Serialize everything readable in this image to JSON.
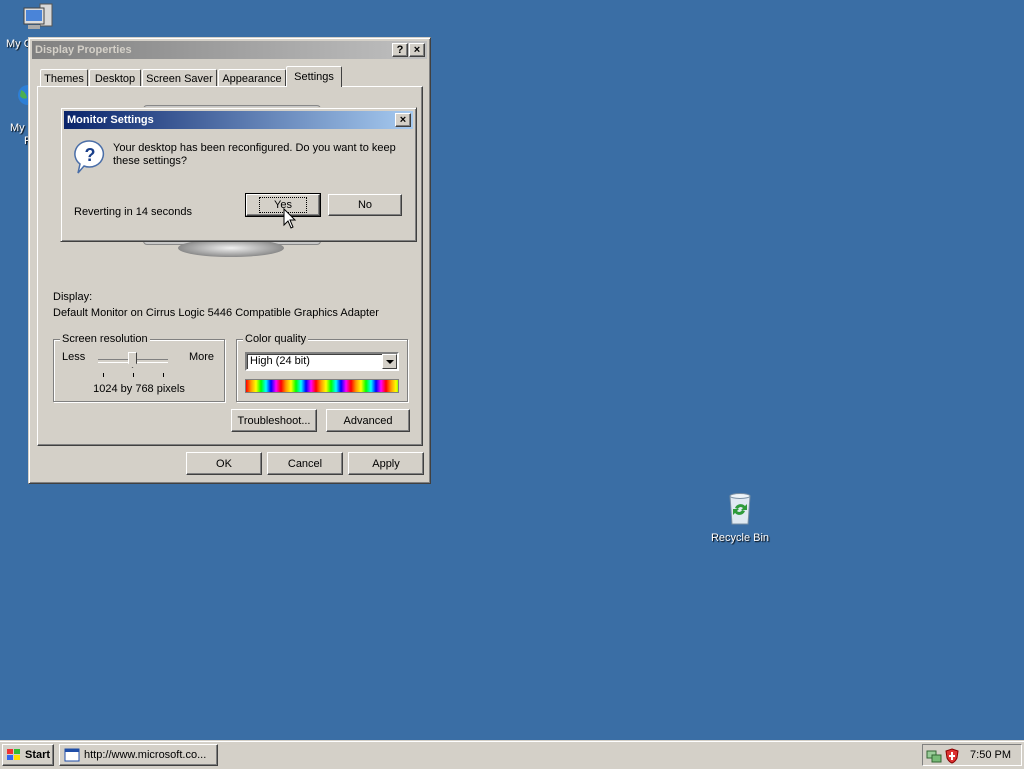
{
  "desktop": {
    "icons": [
      {
        "label": "My C"
      },
      {
        "label": "My"
      },
      {
        "label": "F"
      },
      {
        "label": "Recycle Bin"
      }
    ]
  },
  "display_properties": {
    "title": "Display Properties",
    "help_glyph": "?",
    "close_glyph": "×",
    "tabs": [
      "Themes",
      "Desktop",
      "Screen Saver",
      "Appearance",
      "Settings"
    ],
    "selected_tab": "Settings",
    "display_label": "Display:",
    "display_value": "Default Monitor on Cirrus Logic 5446 Compatible Graphics Adapter",
    "resolution": {
      "legend": "Screen resolution",
      "less": "Less",
      "more": "More",
      "value_text": "1024 by 768 pixels"
    },
    "color_quality": {
      "legend": "Color quality",
      "selected": "High (24 bit)"
    },
    "buttons": {
      "troubleshoot": "Troubleshoot...",
      "advanced": "Advanced",
      "ok": "OK",
      "cancel": "Cancel",
      "apply": "Apply"
    }
  },
  "monitor_settings": {
    "title": "Monitor Settings",
    "close_glyph": "×",
    "message": "Your desktop has been reconfigured.  Do you want to keep these settings?",
    "countdown": "Reverting in 14 seconds",
    "yes": "Yes",
    "no": "No"
  },
  "taskbar": {
    "start": "Start",
    "task_title": "http://www.microsoft.co...",
    "clock": "7:50 PM"
  },
  "colors": {
    "desktop_bg": "#3a6ea5",
    "face": "#d4d0c8",
    "active_title": "#0a246a",
    "inactive_title": "#808080"
  }
}
